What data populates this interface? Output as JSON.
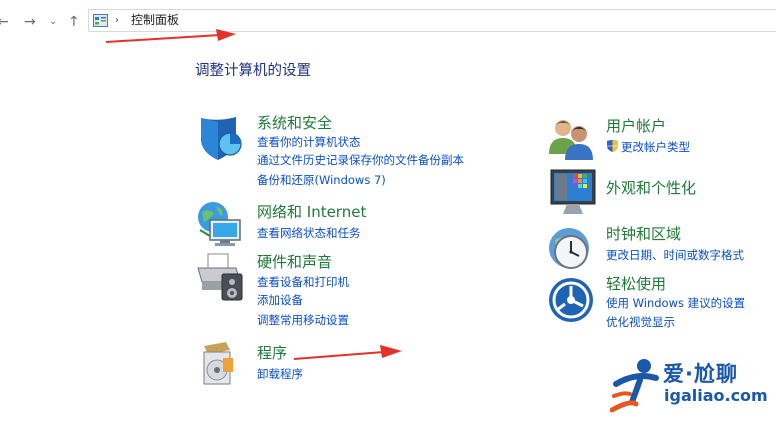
{
  "nav": {
    "back_glyph": "←",
    "forward_glyph": "→",
    "history_glyph": "⌄",
    "up_glyph": "↑",
    "separator": "›",
    "address": "控制面板"
  },
  "heading": "调整计算机的设置",
  "categories": {
    "system": {
      "title": "系统和安全",
      "links": [
        "查看你的计算机状态",
        "通过文件历史记录保存你的文件备份副本",
        "备份和还原(Windows 7)"
      ]
    },
    "network": {
      "title": "网络和 Internet",
      "links": [
        "查看网络状态和任务"
      ]
    },
    "hardware": {
      "title": "硬件和声音",
      "links": [
        "查看设备和打印机",
        "添加设备",
        "调整常用移动设置"
      ]
    },
    "programs": {
      "title": "程序",
      "links": [
        "卸载程序"
      ]
    },
    "users": {
      "title": "用户帐户",
      "links": [
        "更改帐户类型"
      ]
    },
    "appearance": {
      "title": "外观和个性化",
      "links": []
    },
    "clock": {
      "title": "时钟和区域",
      "links": [
        "更改日期、时间或数字格式"
      ]
    },
    "ease": {
      "title": "轻松使用",
      "links": [
        "使用 Windows 建议的设置",
        "优化视觉显示"
      ]
    }
  },
  "watermark": {
    "cn": "爱·尬聊",
    "en": "igaliao.com"
  },
  "colors": {
    "title_green": "#1f7a3a",
    "link_blue": "#0b4fc7",
    "heading_blue": "#1e3287",
    "annotation_red": "#e53228"
  }
}
